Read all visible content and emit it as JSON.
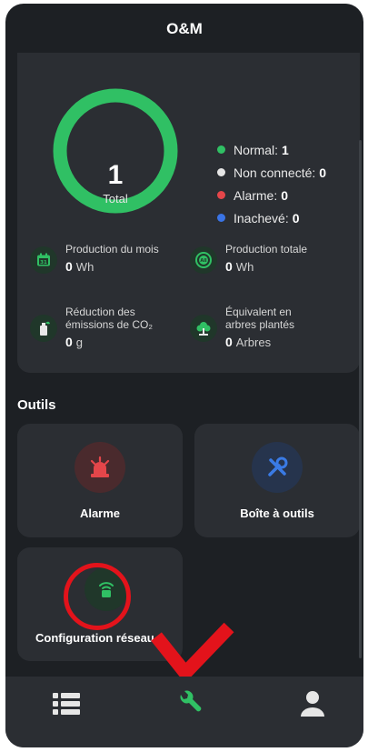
{
  "header": {
    "title": "O&M"
  },
  "summary": {
    "total_value": "1",
    "total_label": "Total",
    "legend": [
      {
        "label": "Normal:",
        "value": "1",
        "color": "#30c064"
      },
      {
        "label": "Non connecté:",
        "value": "0",
        "color": "#e6e6e6"
      },
      {
        "label": "Alarme:",
        "value": "0",
        "color": "#e5464a"
      },
      {
        "label": "Inachevé:",
        "value": "0",
        "color": "#3a74e6"
      }
    ],
    "metrics": [
      {
        "label_lines": [
          "Production du mois"
        ],
        "value": "0",
        "unit": "Wh",
        "icon": "calendar-icon"
      },
      {
        "label_lines": [
          "Production totale"
        ],
        "value": "0",
        "unit": "Wh",
        "icon": "total-energy-icon"
      },
      {
        "label_lines": [
          "Réduction des",
          "émissions de CO₂"
        ],
        "value": "0",
        "unit": "g",
        "icon": "co2-reduction-icon"
      },
      {
        "label_lines": [
          "Équivalent en",
          "arbres plantés"
        ],
        "value": "0",
        "unit": "Arbres",
        "icon": "tree-icon"
      }
    ]
  },
  "tools": {
    "section_title": "Outils",
    "items": [
      {
        "label": "Alarme",
        "icon": "alarm-siren-icon",
        "accent": "#e5464a"
      },
      {
        "label": "Boîte à outils",
        "icon": "toolbox-icon",
        "accent": "#3a7be6"
      },
      {
        "label": "Configuration réseau",
        "icon": "network-config-icon",
        "accent": "#30c064"
      }
    ]
  },
  "tabbar": {
    "items": [
      {
        "icon": "list-icon",
        "active": false
      },
      {
        "icon": "wrench-icon",
        "active": true
      },
      {
        "icon": "user-icon",
        "active": false
      }
    ]
  },
  "annotations": {
    "highlight_color": "#e3131b"
  }
}
